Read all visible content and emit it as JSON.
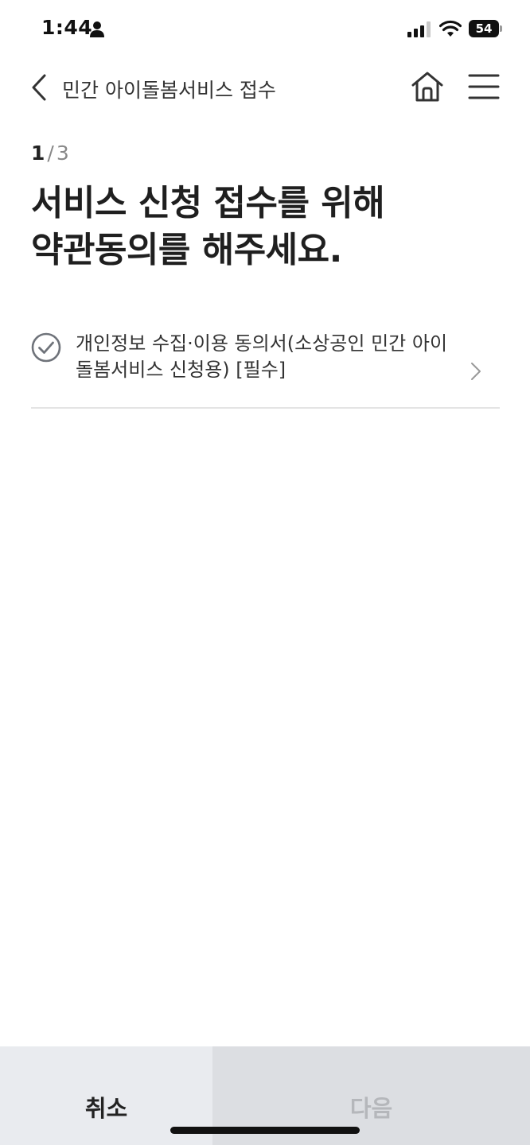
{
  "status_bar": {
    "time": "1:44",
    "battery": "54",
    "icons": [
      "person-icon",
      "signal-icon",
      "wifi-icon",
      "battery-icon"
    ]
  },
  "header": {
    "title": "민간 아이돌봄서비스 접수",
    "icons": [
      "back-icon",
      "home-icon",
      "menu-icon"
    ]
  },
  "step": {
    "current": "1",
    "separator": "/",
    "total": "3"
  },
  "main": {
    "title_line1": "서비스 신청 접수를 위해",
    "title_line2": "약관동의를 해주세요."
  },
  "agreements": [
    {
      "label": "개인정보 수집·이용 동의서(소상공인 민간 아이돌봄서비스 신청용) [필수]",
      "checked": true,
      "icon": "check-circle-icon"
    }
  ],
  "footer": {
    "cancel_label": "취소",
    "next_label": "다음",
    "next_enabled": false
  },
  "colors": {
    "cancel_bg": "#e9ebef",
    "next_bg": "#dcdee2",
    "next_text_disabled": "#b5b7bb",
    "check_gray": "#6f737a"
  }
}
